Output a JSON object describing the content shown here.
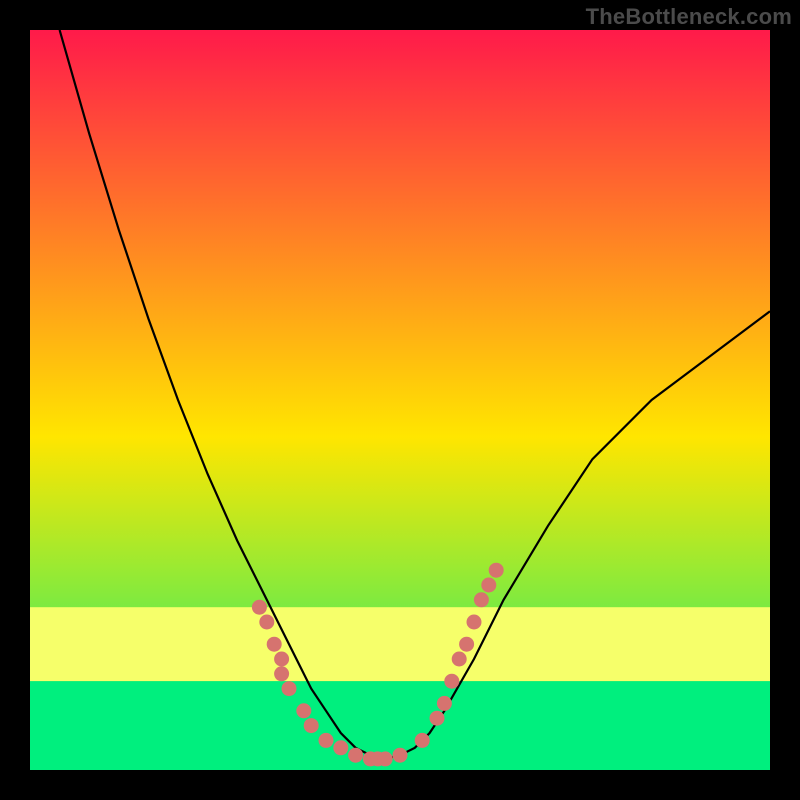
{
  "watermark": "TheBottleneck.com",
  "chart_data": {
    "type": "line",
    "title": "",
    "xlabel": "",
    "ylabel": "",
    "xlim": [
      0,
      100
    ],
    "ylim": [
      0,
      100
    ],
    "grid": false,
    "legend": false,
    "background_gradient": {
      "top_color": "#ff1a4a",
      "mid_color": "#ffe600",
      "bottom_color": "#00ef7e",
      "stops_pct": [
        0,
        55,
        100
      ]
    },
    "bottom_bands": [
      {
        "from_pct": 78,
        "to_pct": 88,
        "color": "#f6ff6a"
      },
      {
        "from_pct": 88,
        "to_pct": 100,
        "color": "#00ef7e"
      }
    ],
    "series": [
      {
        "name": "bottleneck-curve",
        "color": "#000000",
        "x": [
          4,
          8,
          12,
          16,
          20,
          24,
          28,
          32,
          36,
          38,
          40,
          42,
          44,
          46,
          48,
          50,
          52,
          54,
          56,
          60,
          64,
          70,
          76,
          84,
          92,
          100
        ],
        "y": [
          100,
          86,
          73,
          61,
          50,
          40,
          31,
          23,
          15,
          11,
          8,
          5,
          3,
          2,
          1.5,
          2,
          3,
          5,
          8,
          15,
          23,
          33,
          42,
          50,
          56,
          62
        ]
      }
    ],
    "dot_clusters": [
      {
        "name": "left-cluster",
        "color": "#d6736f",
        "points": [
          {
            "x": 31,
            "y": 22
          },
          {
            "x": 32,
            "y": 20
          },
          {
            "x": 33,
            "y": 17
          },
          {
            "x": 34,
            "y": 15
          },
          {
            "x": 34,
            "y": 13
          },
          {
            "x": 35,
            "y": 11
          },
          {
            "x": 37,
            "y": 8
          },
          {
            "x": 38,
            "y": 6
          },
          {
            "x": 40,
            "y": 4
          },
          {
            "x": 42,
            "y": 3
          },
          {
            "x": 44,
            "y": 2
          },
          {
            "x": 46,
            "y": 1.5
          },
          {
            "x": 47,
            "y": 1.5
          },
          {
            "x": 48,
            "y": 1.5
          },
          {
            "x": 50,
            "y": 2
          }
        ]
      },
      {
        "name": "right-cluster",
        "color": "#d6736f",
        "points": [
          {
            "x": 53,
            "y": 4
          },
          {
            "x": 55,
            "y": 7
          },
          {
            "x": 56,
            "y": 9
          },
          {
            "x": 57,
            "y": 12
          },
          {
            "x": 58,
            "y": 15
          },
          {
            "x": 59,
            "y": 17
          },
          {
            "x": 60,
            "y": 20
          },
          {
            "x": 61,
            "y": 23
          },
          {
            "x": 62,
            "y": 25
          },
          {
            "x": 63,
            "y": 27
          }
        ]
      }
    ]
  }
}
